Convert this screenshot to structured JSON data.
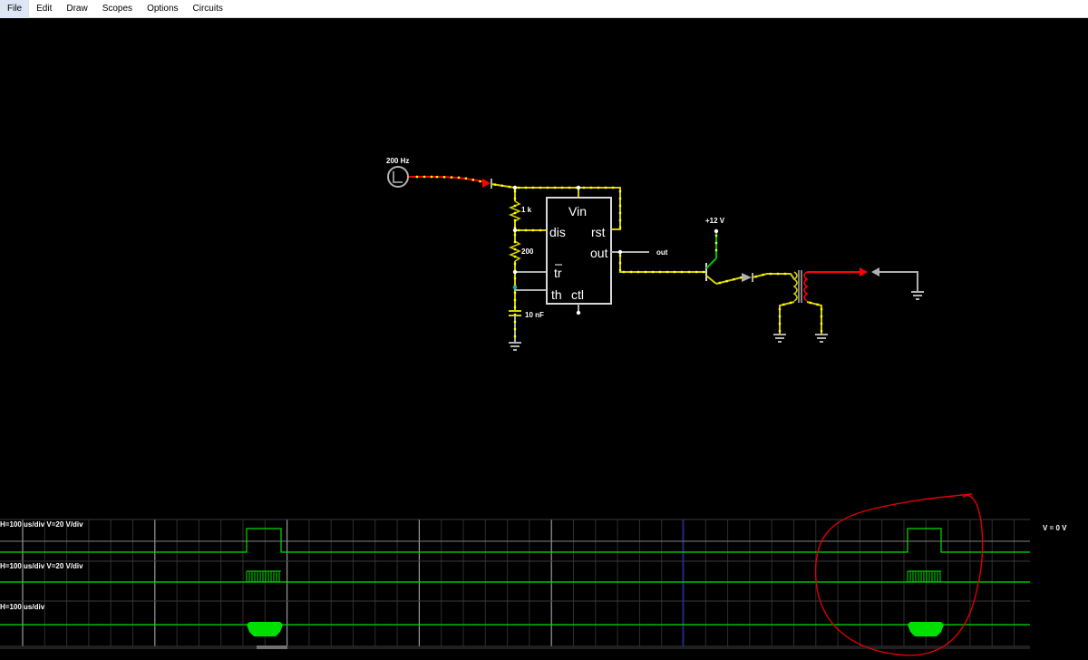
{
  "menu": {
    "items": [
      "File",
      "Edit",
      "Draw",
      "Scopes",
      "Options",
      "Circuits"
    ]
  },
  "circuit": {
    "source_label": "200 Hz",
    "r1_label": "1 k",
    "r2_label": "200",
    "cap_label": "10 nF",
    "chip": {
      "vin": "Vin",
      "dis": "dis",
      "rst": "rst",
      "out": "out",
      "tr": "tr",
      "th": "th",
      "ctl": "ctl"
    },
    "out_label": "out",
    "supply_label": "+12 V"
  },
  "scopes": {
    "scope1_label": "H=100 us/div V=20 V/div",
    "scope2_label": "H=100 us/div V=20 V/div",
    "scope3_label": "H=100 us/div",
    "side_readout": "V = 0 V"
  },
  "colors": {
    "background": "#000000",
    "wire_low": "#808080",
    "wire_high": "#ff0000",
    "wire_positive": "#00c000",
    "current_dots": "#ffff00",
    "trace": "#00ff00",
    "annotation": "#e00000"
  }
}
